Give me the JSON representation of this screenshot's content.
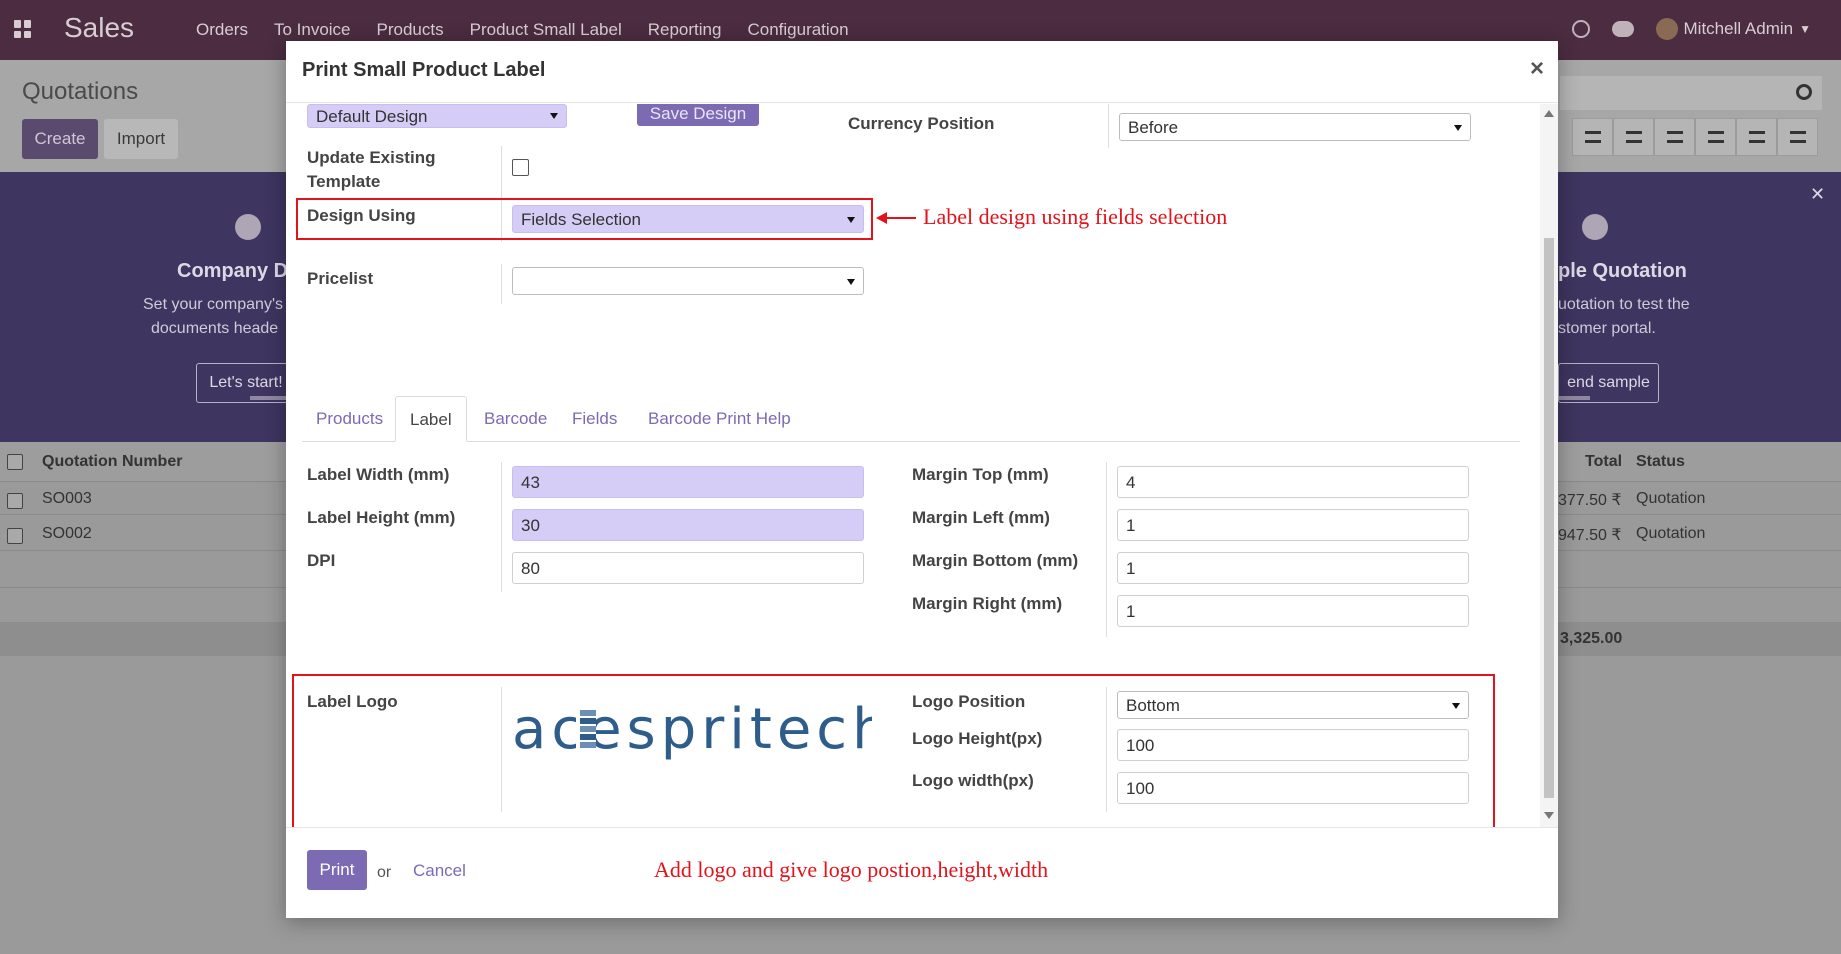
{
  "app": {
    "brand": "Sales",
    "menu": [
      "Orders",
      "To Invoice",
      "Products",
      "Product Small Label",
      "Reporting",
      "Configuration"
    ],
    "user": "Mitchell Admin"
  },
  "control_panel": {
    "title": "Quotations",
    "create_label": "Create",
    "import_label": "Import"
  },
  "banner": {
    "left_title": "Company D",
    "left_text_1": "Set your company's",
    "left_text_2": "documents heade",
    "left_button": "Let's start!",
    "right_title": "ple Quotation",
    "right_text_1": "uotation to test the",
    "right_text_2": "stomer portal.",
    "right_button": "end sample"
  },
  "list": {
    "col_number": "Quotation Number",
    "col_total": "Total",
    "col_status": "Status",
    "rows": [
      {
        "number": "SO003",
        "total": "377.50 ₹",
        "status": "Quotation"
      },
      {
        "number": "SO002",
        "total": "947.50 ₹",
        "status": "Quotation"
      }
    ],
    "sum": "3,325.00"
  },
  "modal": {
    "title": "Print Small Product Label",
    "design_select": "Default Design",
    "save_design_label": "Save Design",
    "update_label": "Update Existing Template",
    "design_using_label": "Design Using",
    "design_using_value": "Fields Selection",
    "pricelist_label": "Pricelist",
    "pricelist_value": "",
    "currency_position_label": "Currency Position",
    "currency_position_value": "Before",
    "tabs": [
      "Products",
      "Label",
      "Barcode",
      "Fields",
      "Barcode Print Help"
    ],
    "label_width_label": "Label Width (mm)",
    "label_width_value": "43",
    "label_height_label": "Label Height (mm)",
    "label_height_value": "30",
    "dpi_label": "DPI",
    "dpi_value": "80",
    "margin_top_label": "Margin Top (mm)",
    "margin_top_value": "4",
    "margin_left_label": "Margin Left (mm)",
    "margin_left_value": "1",
    "margin_bottom_label": "Margin Bottom (mm)",
    "margin_bottom_value": "1",
    "margin_right_label": "Margin Right (mm)",
    "margin_right_value": "1",
    "label_logo_label": "Label Logo",
    "logo_text": "acespritech",
    "logo_position_label": "Logo Position",
    "logo_position_value": "Bottom",
    "logo_height_label": "Logo Height(px)",
    "logo_height_value": "100",
    "logo_width_label": "Logo width(px)",
    "logo_width_value": "100",
    "print_label": "Print",
    "or_label": "or",
    "cancel_label": "Cancel"
  },
  "annotations": {
    "design": "Label design using fields selection",
    "logo": "Add logo and give logo postion,height,width"
  },
  "colors": {
    "accent": "#7c6ab3",
    "annotation": "#e3121b",
    "topbar": "#4b2c40"
  }
}
